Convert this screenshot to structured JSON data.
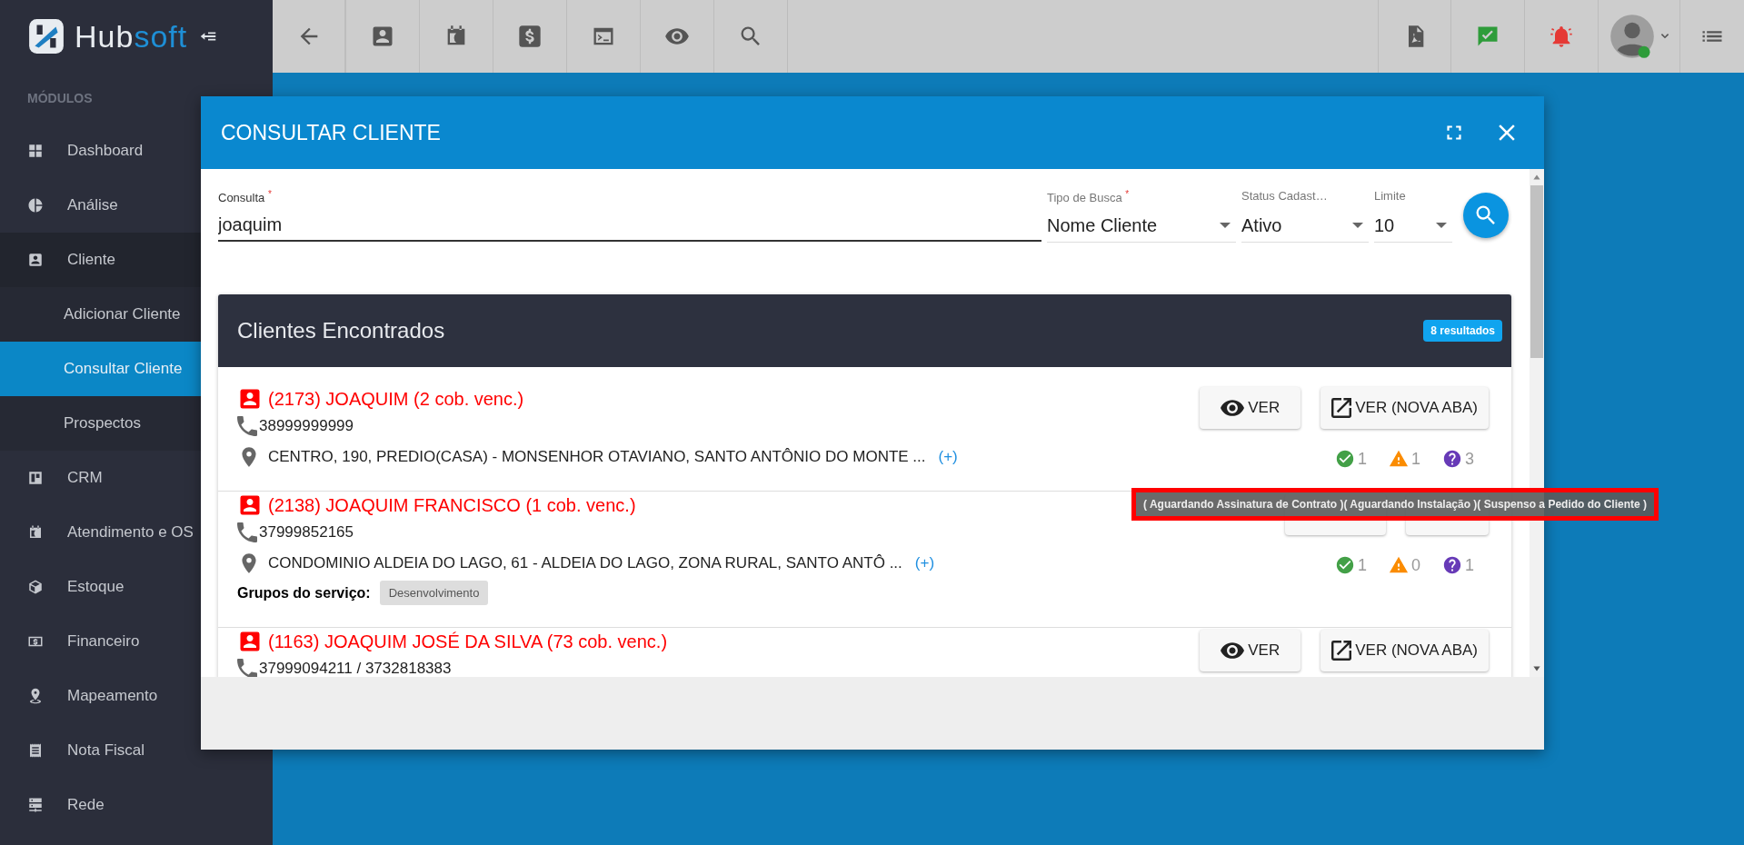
{
  "brand": {
    "name_left": "Hub",
    "name_right": "soft"
  },
  "sidebar": {
    "heading": "MÓDULOS",
    "items": [
      {
        "label": "Dashboard",
        "selected": false
      },
      {
        "label": "Análise",
        "selected": false
      },
      {
        "label": "Cliente",
        "selected": false,
        "expanded": true,
        "children": [
          {
            "label": "Adicionar Cliente",
            "selected": false
          },
          {
            "label": "Consultar Cliente",
            "selected": true
          },
          {
            "label": "Prospectos",
            "selected": false
          }
        ]
      },
      {
        "label": "CRM",
        "selected": false
      },
      {
        "label": "Atendimento e OS",
        "selected": false
      },
      {
        "label": "Estoque",
        "selected": false
      },
      {
        "label": "Financeiro",
        "selected": false
      },
      {
        "label": "Mapeamento",
        "selected": false
      },
      {
        "label": "Nota Fiscal",
        "selected": false
      },
      {
        "label": "Rede",
        "selected": false
      }
    ]
  },
  "dialog": {
    "title": "CONSULTAR CLIENTE",
    "query": {
      "label": "Consulta $^{*}$",
      "value": "joaquim"
    },
    "selects": [
      {
        "label": "Tipo de Busca $^{*}$",
        "value": "Nome Cliente"
      },
      {
        "label": "Status Cadast…",
        "value": "Ativo"
      },
      {
        "label": "Limite",
        "value": "10"
      }
    ],
    "results": {
      "title": "Clientes Encontrados",
      "count": "8 resultados",
      "rows": [
        {
          "name": "(2173) JOAQUIM (2 cob. venc.)",
          "phone": "38999999999",
          "address": "CENTRO, 190, PREDIO(CASA) - MONSENHOR OTAVIANO, SANTO ANTÔNIO DO MONTE ...",
          "more": "(+)",
          "stats": [
            "1",
            "1",
            "3"
          ],
          "buttons": [
            "VER",
            "VER (NOVA ABA)"
          ]
        },
        {
          "name": "(2138) JOAQUIM FRANCISCO (1 cob. venc.)",
          "phone": "37999852165",
          "address": "CONDOMINIO ALDEIA DO LAGO, 61 - ALDEIA DO LAGO, ZONA RURAL, SANTO ANTÔ ...",
          "more": "(+)",
          "group_label": "Grupos do serviço:",
          "group_tag": "Desenvolvimento",
          "stats": [
            "1",
            "0",
            "1"
          ],
          "buttons_covered": true
        },
        {
          "name": "(1163) JOAQUIM JOSÉ DA SILVA (73 cob. venc.)",
          "phone": "37999094211 / 3732818383",
          "buttons": [
            "VER",
            "VER (NOVA ABA)"
          ]
        }
      ]
    },
    "tooltip": {
      "text": "( Aguardando Assinatura de Contrato )( Aguardando Instalação )( Suspenso a Pedido do Cliente )",
      "highlighted": true
    }
  }
}
